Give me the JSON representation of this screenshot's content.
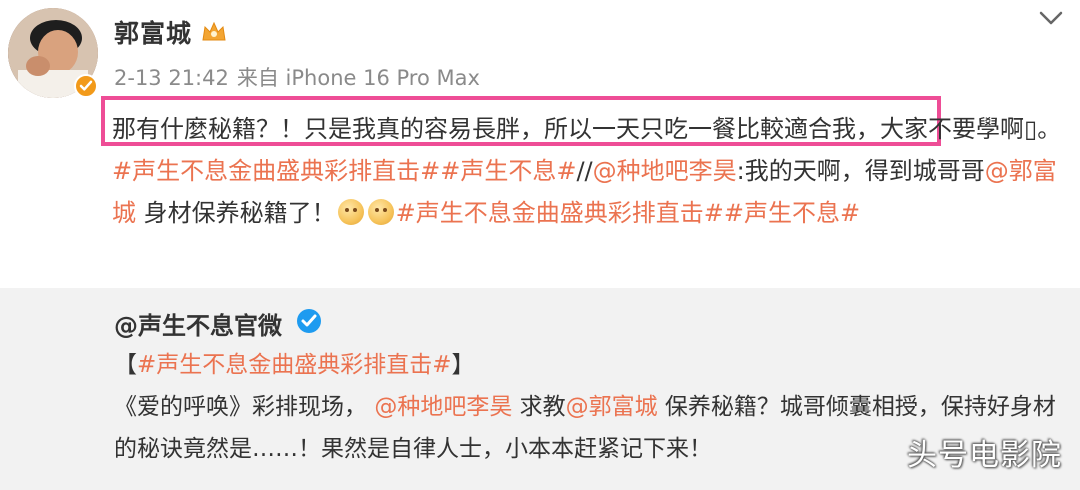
{
  "post": {
    "username": "郭富城",
    "time": "2-13 21:42",
    "source": "来自 iPhone 16 Pro Max",
    "content": {
      "highlighted": "那有什麼秘籍？！只是我真的容易長胖，所以一天只吃一餐比較適合我",
      "rest": "，大家不要學啊",
      "glyph": "▯",
      "tag_rehearsal": "#声生不息金曲盛典彩排直击#",
      "tag_show": "#声生不息#",
      "slashes": "//",
      "mention_lihao": "@种地吧李昊",
      "lihao_text": ":我的天啊，得到城哥哥",
      "mention_guo": "@郭富城",
      "guo_text": " 身材保养秘籍了！",
      "tag_rehearsal2": "#声生不息金曲盛典彩排直击#",
      "tag_show2": "#声生不息#"
    },
    "highlight_color": "#ee4d96",
    "link_color": "#eb7350"
  },
  "repost": {
    "author": "@声生不息官微",
    "bracket_open": "【",
    "tag": "#声生不息金曲盛典彩排直击#",
    "bracket_close": "】",
    "line2_a": "《爱的呼唤》彩排现场，",
    "mention_lihao": "@种地吧李昊",
    "line2_b": " 求教",
    "mention_guo": "@郭富城",
    "line2_c": " 保养秘籍？城哥倾囊相授，保持好身材的秘诀竟然是……！果然是自律人士，小本本赶紧记下来！"
  },
  "watermark": "头号电影院",
  "icons": [
    "avatar",
    "verified-badge-icon",
    "crown-icon",
    "chevron-down-icon",
    "blue-verified-icon",
    "emoji-icon"
  ]
}
